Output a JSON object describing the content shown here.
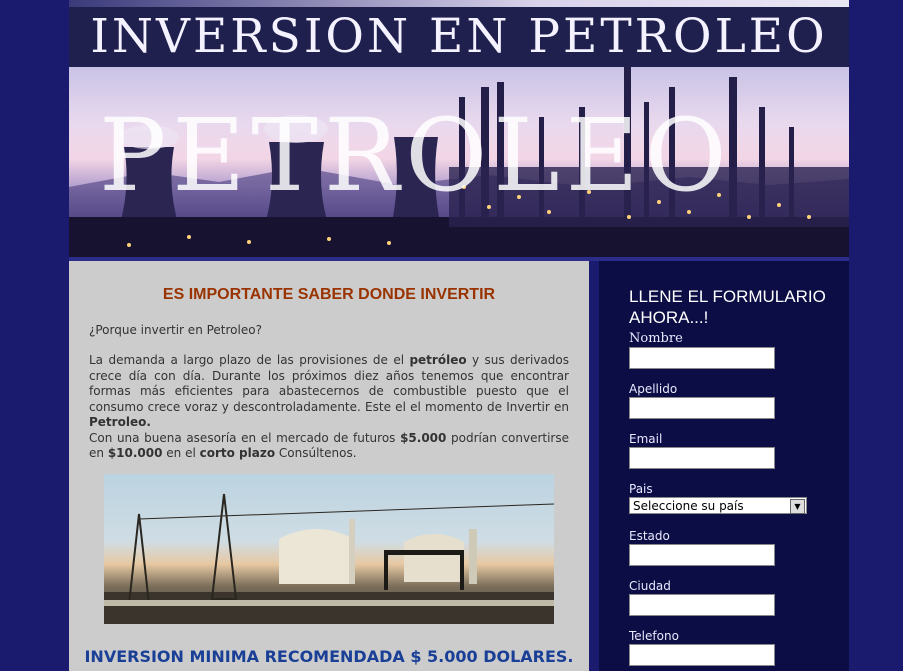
{
  "header": {
    "title": "INVERSION EN PETROLEO",
    "banner_watermark": "PETROLEO"
  },
  "main": {
    "headline": "ES IMPORTANTE SABER DONDE INVERTIR",
    "question": "¿Porque invertir en Petroleo?",
    "paragraph_1a": "La demanda a largo plazo de las provisiones de el ",
    "paragraph_1b": "petróleo",
    "paragraph_1c": " y sus derivados crece día con día. Durante los próximos diez años tenemos que encontrar formas más eficientes para abastecernos de combustible puesto que el consumo crece voraz y descontroladamente. Este el el momento de Invertir en ",
    "paragraph_1d": "Petroleo.",
    "paragraph_2a": "Con una buena asesoría en el mercado de futuros ",
    "paragraph_2b": "$5.000",
    "paragraph_2c": " podrían convertirse en ",
    "paragraph_2d": "$10.000",
    "paragraph_2e": " en el ",
    "paragraph_2f": "corto plazo",
    "paragraph_2g": " Consúltenos.",
    "footer_note": "INVERSION MINIMA RECOMENDADA $ 5.000 DOLARES."
  },
  "form": {
    "title": "LLENE EL FORMULARIO AHORA...!",
    "fields": {
      "nombre": "Nombre",
      "apellido": "Apellido",
      "email": "Email",
      "pais": "Pais",
      "pais_selected": "Seleccione su país",
      "estado": "Estado",
      "ciudad": "Ciudad",
      "telefono": "Telefono"
    }
  },
  "colors": {
    "background": "#1a1a6e",
    "headline": "#993300",
    "footer_note": "#1a3f96",
    "form_panel": "#0d0d45"
  }
}
